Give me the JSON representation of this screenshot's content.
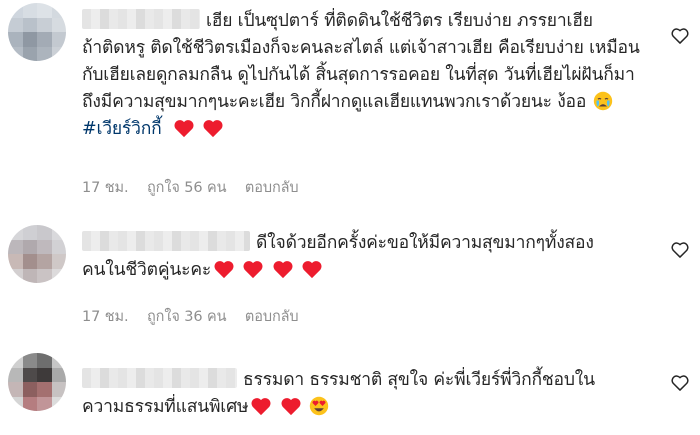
{
  "comments": [
    {
      "text_line1": "เฮีย เป็นซุปตาร์ ที่ติดดินใช้ชีวิตร เรียบง่าย ภรรยาเฮีย",
      "text_rest": "ถ้าติดหรู ติดใช้ชีวิตรเมืองก็จะคนละสไตล์ แต่เจ้าสาวเฮีย คือเรียบง่าย เหมือนกับเฮียเลยดูกลมกลืน ดูไปกันได้ สิ้นสุดการรอคอย ในที่สุด วันที่เฮียไผ่ฝันก็มาถึงมีความสุขมากๆนะคะเฮีย วิกกี้ฝากดูแลเฮียแทนพวกเราด้วยนะ ง้ออ",
      "emoji": [
        "crying-face-icon"
      ],
      "hashtag": "#เวียร์วิกกี้",
      "trailing_emoji": [
        "red-heart-icon",
        "red-heart-icon"
      ],
      "time": "17 ชม.",
      "likes": "ถูกใจ 56 คน",
      "reply": "ตอบกลับ"
    },
    {
      "text_line1": "ดีใจด้วยอีกครั้งค่ะขอให้มีความสุขมากๆทั้งสอง",
      "text_rest": "คนในชีวิตคู่นะคะ",
      "trailing_emoji": [
        "red-heart-icon",
        "red-heart-icon",
        "red-heart-icon",
        "red-heart-icon"
      ],
      "time": "17 ชม.",
      "likes": "ถูกใจ 36 คน",
      "reply": "ตอบกลับ"
    },
    {
      "text_line1": "ธรรมดา ธรรมชาติ สุขใจ ค่ะพี่เวียร์พี่วิกกี้ชอบใน",
      "text_rest": "ความธรรมที่แสนพิเศษ",
      "trailing_emoji": [
        "red-heart-icon",
        "red-heart-icon",
        "heart-eyes-icon"
      ]
    }
  ],
  "colors": {
    "text": "#262626",
    "meta": "#8e8e8e",
    "hashtag": "#00376b",
    "heart": "#ed1c2e"
  }
}
